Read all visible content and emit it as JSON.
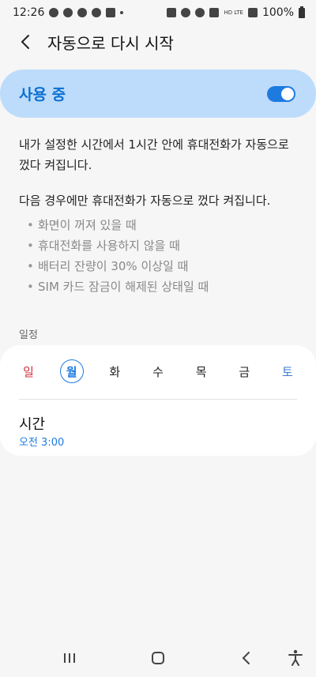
{
  "status_bar": {
    "time": "12:26",
    "network_labels": "HD LTE",
    "battery_text": "100%"
  },
  "header": {
    "title": "자동으로 다시 시작",
    "back_icon": "chevron-left-icon"
  },
  "toggle": {
    "label": "사용 중",
    "state": "on",
    "accent_color": "#1d7be0"
  },
  "description": {
    "line1": "내가 설정한 시간에서 1시간 안에 휴대전화가 자동으로 껐다 켜집니다.",
    "line2": "다음 경우에만 휴대전화가 자동으로 껐다 켜집니다.",
    "conditions": [
      "화면이 꺼져 있을 때",
      "휴대전화를 사용하지 않을 때",
      "배터리 잔량이 30% 이상일 때",
      "SIM 카드 잠금이 해제된 상태일 때"
    ]
  },
  "schedule": {
    "section_label": "일정",
    "days": [
      {
        "label": "일",
        "selected": false
      },
      {
        "label": "월",
        "selected": true
      },
      {
        "label": "화",
        "selected": false
      },
      {
        "label": "수",
        "selected": false
      },
      {
        "label": "목",
        "selected": false
      },
      {
        "label": "금",
        "selected": false
      },
      {
        "label": "토",
        "selected": false
      }
    ],
    "time_title": "시간",
    "time_value": "오전 3:00"
  },
  "nav_bar": {
    "icons": [
      "recent-apps-icon",
      "home-icon",
      "back-icon",
      "accessibility-icon"
    ]
  }
}
